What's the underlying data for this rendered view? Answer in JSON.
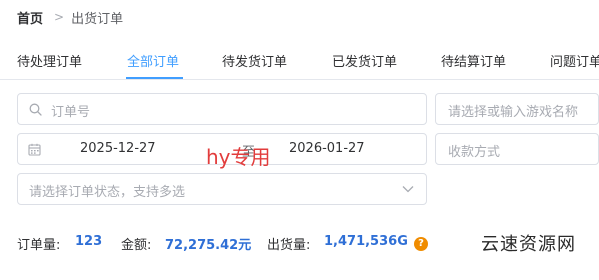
{
  "breadcrumb": {
    "home": "首页",
    "separator": ">",
    "current": "出货订单"
  },
  "tabs": [
    {
      "label": "待处理订单"
    },
    {
      "label": "全部订单",
      "active": true
    },
    {
      "label": "待发货订单"
    },
    {
      "label": "已发货订单"
    },
    {
      "label": "待结算订单"
    },
    {
      "label": "问题订单"
    }
  ],
  "filters": {
    "order_no_placeholder": "订单号",
    "game_placeholder": "请选择或输入游戏名称",
    "date_start": "2025-12-27",
    "date_separator": "至",
    "date_end": "2026-01-27",
    "payment_placeholder": "收款方式",
    "status_placeholder": "请选择订单状态，支持多选"
  },
  "watermark": "hy专用",
  "stats": {
    "order_count_label": "订单量:",
    "order_count_value": "123",
    "amount_label": "金额:",
    "amount_value": "72,275.42元",
    "shipped_label": "出货量:",
    "shipped_value": "1,471,536G",
    "help_glyph": "?"
  },
  "site_watermark": "云速资源网",
  "colors": {
    "accent": "#409eff",
    "stat_value": "#2f6fd6",
    "help": "#f08c00",
    "watermark": "#e23c3c"
  }
}
